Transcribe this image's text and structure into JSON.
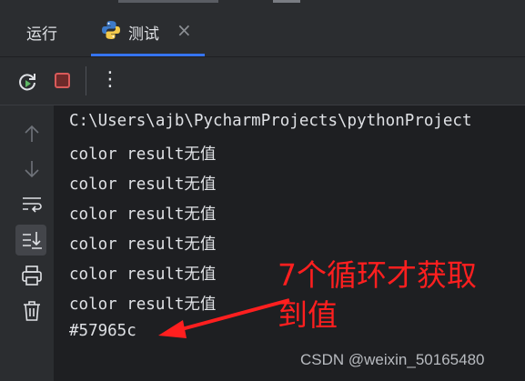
{
  "tabs": [
    {
      "label": "运行"
    },
    {
      "label": "测试",
      "close_icon": "close-icon"
    }
  ],
  "toolbar": {
    "icons": [
      "rerun-icon",
      "stop-icon",
      "more-vertical-icon"
    ],
    "more_label": "⋮"
  },
  "sidebar": {
    "icons": [
      "arrow-up-icon",
      "arrow-down-icon",
      "soft-wrap-icon",
      "scroll-to-end-icon",
      "print-icon",
      "trash-icon"
    ]
  },
  "console": {
    "lines": [
      "C:\\Users\\ajb\\PycharmProjects\\pythonProject",
      "color result无值",
      "color result无值",
      "color result无值",
      "color result无值",
      "color result无值",
      "color result无值",
      "#57965c"
    ]
  },
  "annotation": {
    "text": "7个循环才获取到值",
    "color": "#ff1f1f"
  },
  "watermark": "CSDN @weixin_50165480",
  "colors": {
    "accent": "#3574f0",
    "background": "#1e1f22",
    "panel": "#2b2d30",
    "stop": "#d95a5a"
  }
}
